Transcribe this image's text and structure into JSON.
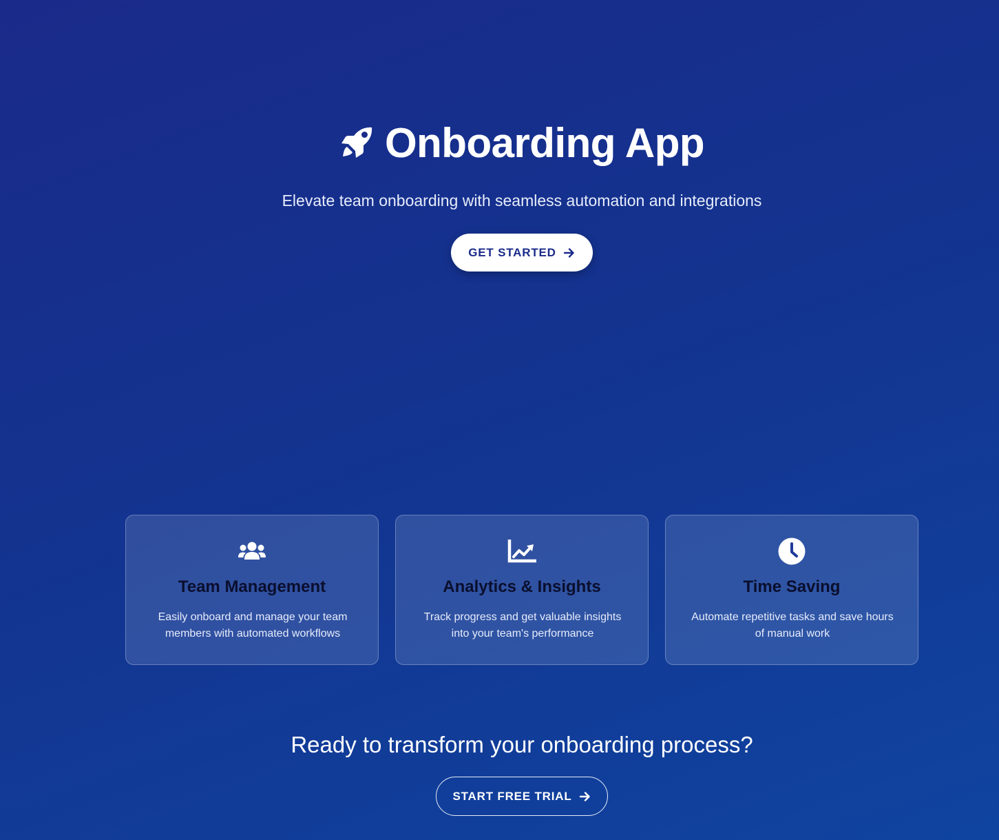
{
  "hero": {
    "icon": "rocket-icon",
    "title": "Onboarding App",
    "subtitle": "Elevate team onboarding with seamless automation and integrations",
    "cta_label": "GET STARTED",
    "cta_icon": "arrow-right-icon"
  },
  "features": [
    {
      "icon": "users-icon",
      "title": "Team Management",
      "description": "Easily onboard and manage your team members with automated workflows"
    },
    {
      "icon": "chart-line-icon",
      "title": "Analytics & Insights",
      "description": "Track progress and get valuable insights into your team's performance"
    },
    {
      "icon": "clock-icon",
      "title": "Time Saving",
      "description": "Automate repetitive tasks and save hours of manual work"
    }
  ],
  "cta": {
    "heading": "Ready to transform your onboarding process?",
    "button_label": "START FREE TRIAL",
    "button_icon": "arrow-right-icon"
  },
  "colors": {
    "background_start": "#1a2a8a",
    "background_end": "#0f44a0",
    "primary_button_bg": "#ffffff",
    "primary_button_text": "#1a2a8a",
    "card_title": "#0a0f2e"
  }
}
